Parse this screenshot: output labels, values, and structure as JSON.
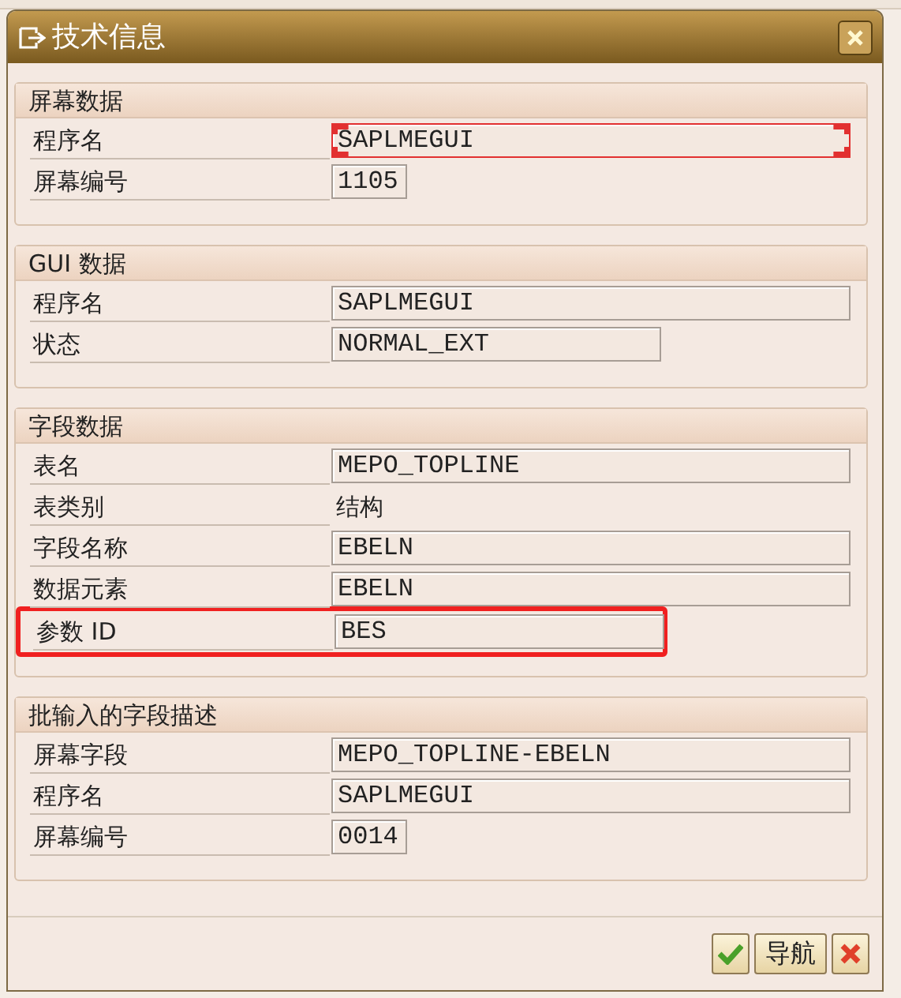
{
  "window": {
    "title": "技术信息"
  },
  "sections": [
    {
      "title": "屏幕数据",
      "rows": [
        {
          "label": "程序名",
          "value": "SAPLMEGUI",
          "kind": "long",
          "focused": true,
          "highlighted": false
        },
        {
          "label": "屏幕编号",
          "value": "1105",
          "kind": "short",
          "focused": false,
          "highlighted": false
        }
      ]
    },
    {
      "title": "GUI 数据",
      "rows": [
        {
          "label": "程序名",
          "value": "SAPLMEGUI",
          "kind": "long",
          "focused": false,
          "highlighted": false
        },
        {
          "label": "状态",
          "value": "NORMAL_EXT",
          "kind": "medium",
          "focused": false,
          "highlighted": false
        }
      ]
    },
    {
      "title": "字段数据",
      "rows": [
        {
          "label": "表名",
          "value": "MEPO_TOPLINE",
          "kind": "long",
          "focused": false,
          "highlighted": false
        },
        {
          "label": "表类别",
          "value": "结构",
          "kind": "text",
          "highlighted": false
        },
        {
          "label": "字段名称",
          "value": "EBELN",
          "kind": "long",
          "focused": false,
          "highlighted": false
        },
        {
          "label": "数据元素",
          "value": "EBELN",
          "kind": "long",
          "focused": false,
          "highlighted": false
        },
        {
          "label": "参数 ID",
          "value": "BES",
          "kind": "medium",
          "focused": false,
          "highlighted": true
        }
      ]
    },
    {
      "title": "批输入的字段描述",
      "rows": [
        {
          "label": "屏幕字段",
          "value": "MEPO_TOPLINE-EBELN",
          "kind": "long",
          "focused": false,
          "highlighted": false
        },
        {
          "label": "程序名",
          "value": "SAPLMEGUI",
          "kind": "long",
          "focused": false,
          "highlighted": false
        },
        {
          "label": "屏幕编号",
          "value": "0014",
          "kind": "short",
          "focused": false,
          "highlighted": false
        }
      ]
    }
  ],
  "buttons": [
    {
      "kind": "confirm"
    },
    {
      "kind": "text",
      "label": "导航"
    },
    {
      "kind": "cancel"
    }
  ]
}
